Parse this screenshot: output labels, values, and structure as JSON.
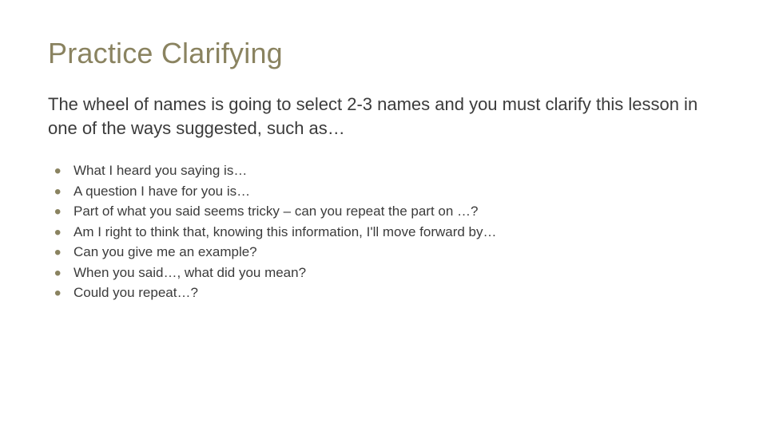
{
  "slide": {
    "title": "Practice Clarifying",
    "intro": "The wheel of names is going to select 2-3 names and you must clarify this lesson in one of the ways suggested, such as…",
    "bullets": [
      "What I heard you saying is…",
      "A question I have for you is…",
      "Part of what you said seems tricky – can you repeat the part on …?",
      "Am I right to think that, knowing this information, I'll move forward by…",
      "Can you give me an example?",
      "When you said…, what did you mean?",
      "Could you repeat…?"
    ]
  }
}
